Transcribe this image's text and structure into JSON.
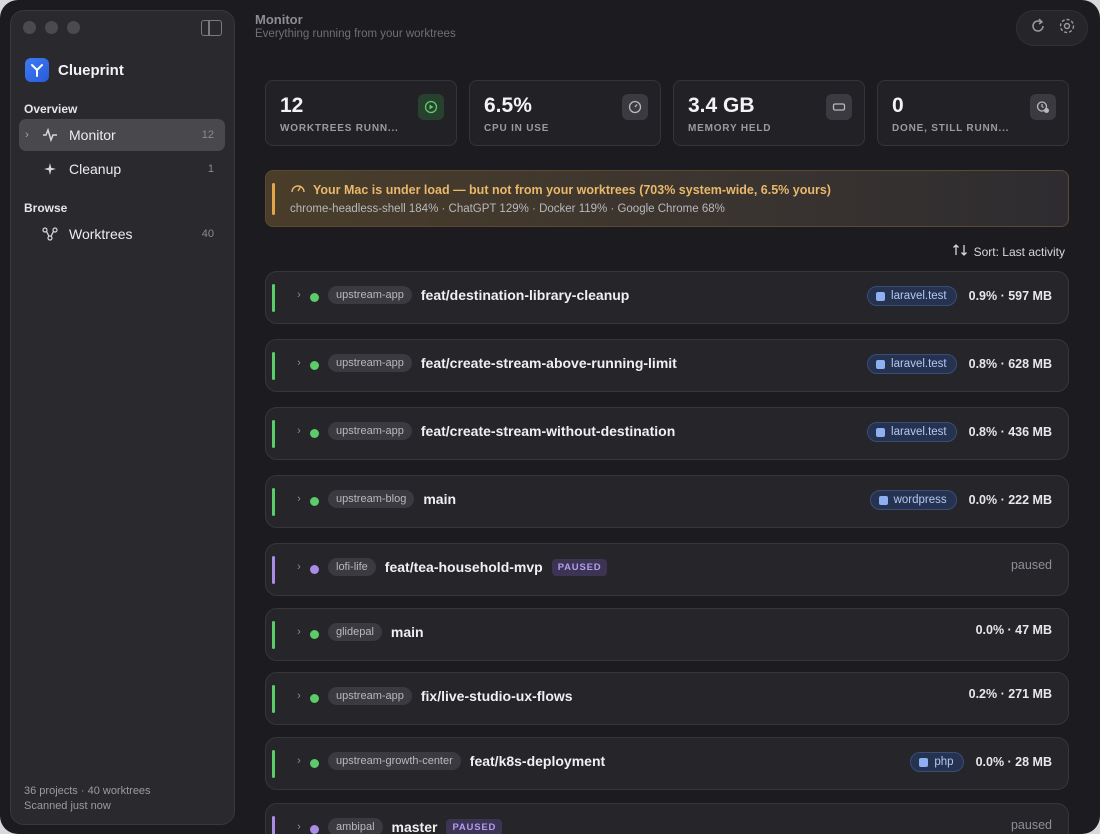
{
  "app": {
    "name": "Clueprint"
  },
  "sidebar": {
    "overview_label": "Overview",
    "browse_label": "Browse",
    "items": [
      {
        "label": "Monitor",
        "count": "12",
        "icon": "activity-icon",
        "active": true
      },
      {
        "label": "Cleanup",
        "count": "1",
        "icon": "sparkle-icon"
      },
      {
        "label": "Worktrees",
        "count": "40",
        "icon": "branch-icon"
      }
    ],
    "footer": {
      "line1": "36 projects · 40 worktrees",
      "line2": "Scanned just now"
    }
  },
  "header": {
    "title": "Monitor",
    "subtitle": "Everything running from your worktrees"
  },
  "stats": [
    {
      "value": "12",
      "label": "WORKTREES RUNN...",
      "icon": "play-icon"
    },
    {
      "value": "6.5%",
      "label": "CPU IN USE",
      "icon": "gauge-icon"
    },
    {
      "value": "3.4 GB",
      "label": "MEMORY HELD",
      "icon": "memory-icon"
    },
    {
      "value": "0",
      "label": "DONE, STILL RUNN...",
      "icon": "clock-check-icon"
    }
  ],
  "alert": {
    "title": "Your Mac is under load — but not from your worktrees (703% system-wide, 6.5% yours)",
    "detail": "chrome-headless-shell 184% · ChatGPT 129% · Docker 119% · Google Chrome 68%",
    "color": "#e9b86a"
  },
  "sort": {
    "label": "Sort: Last activity"
  },
  "rows": [
    {
      "project": "upstream-app",
      "branch": "feat/destination-library-cleanup",
      "site": "laravel.test",
      "metrics": "0.9% · 597 MB"
    },
    {
      "project": "upstream-app",
      "branch": "feat/create-stream-above-running-limit",
      "site": "laravel.test",
      "metrics": "0.8% · 628 MB"
    },
    {
      "project": "upstream-app",
      "branch": "feat/create-stream-without-destination",
      "site": "laravel.test",
      "metrics": "0.8% · 436 MB"
    },
    {
      "project": "upstream-blog",
      "branch": "main",
      "site": "wordpress",
      "metrics": "0.0% · 222 MB"
    },
    {
      "project": "lofi-life",
      "branch": "feat/tea-household-mvp",
      "badge": "PAUSED",
      "status": "paused"
    },
    {
      "project": "glidepal",
      "branch": "main",
      "metrics": "0.0% · 47 MB"
    },
    {
      "project": "upstream-app",
      "branch": "fix/live-studio-ux-flows",
      "metrics": "0.2% · 271 MB"
    },
    {
      "project": "upstream-growth-center",
      "branch": "feat/k8s-deployment",
      "site": "php",
      "metrics": "0.0% · 28 MB"
    },
    {
      "project": "ambipal",
      "branch": "master",
      "badge": "PAUSED",
      "status": "paused"
    }
  ]
}
